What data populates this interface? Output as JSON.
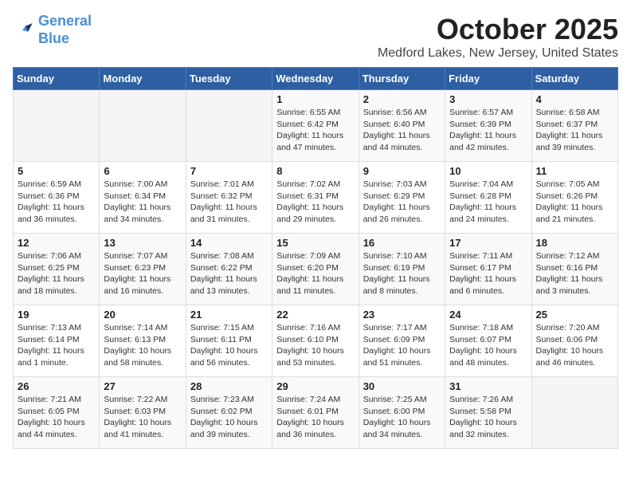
{
  "logo": {
    "line1": "General",
    "line2": "Blue"
  },
  "title": "October 2025",
  "subtitle": "Medford Lakes, New Jersey, United States",
  "weekdays": [
    "Sunday",
    "Monday",
    "Tuesday",
    "Wednesday",
    "Thursday",
    "Friday",
    "Saturday"
  ],
  "weeks": [
    [
      {
        "day": "",
        "info": ""
      },
      {
        "day": "",
        "info": ""
      },
      {
        "day": "",
        "info": ""
      },
      {
        "day": "1",
        "info": "Sunrise: 6:55 AM\nSunset: 6:42 PM\nDaylight: 11 hours and 47 minutes."
      },
      {
        "day": "2",
        "info": "Sunrise: 6:56 AM\nSunset: 6:40 PM\nDaylight: 11 hours and 44 minutes."
      },
      {
        "day": "3",
        "info": "Sunrise: 6:57 AM\nSunset: 6:39 PM\nDaylight: 11 hours and 42 minutes."
      },
      {
        "day": "4",
        "info": "Sunrise: 6:58 AM\nSunset: 6:37 PM\nDaylight: 11 hours and 39 minutes."
      }
    ],
    [
      {
        "day": "5",
        "info": "Sunrise: 6:59 AM\nSunset: 6:36 PM\nDaylight: 11 hours and 36 minutes."
      },
      {
        "day": "6",
        "info": "Sunrise: 7:00 AM\nSunset: 6:34 PM\nDaylight: 11 hours and 34 minutes."
      },
      {
        "day": "7",
        "info": "Sunrise: 7:01 AM\nSunset: 6:32 PM\nDaylight: 11 hours and 31 minutes."
      },
      {
        "day": "8",
        "info": "Sunrise: 7:02 AM\nSunset: 6:31 PM\nDaylight: 11 hours and 29 minutes."
      },
      {
        "day": "9",
        "info": "Sunrise: 7:03 AM\nSunset: 6:29 PM\nDaylight: 11 hours and 26 minutes."
      },
      {
        "day": "10",
        "info": "Sunrise: 7:04 AM\nSunset: 6:28 PM\nDaylight: 11 hours and 24 minutes."
      },
      {
        "day": "11",
        "info": "Sunrise: 7:05 AM\nSunset: 6:26 PM\nDaylight: 11 hours and 21 minutes."
      }
    ],
    [
      {
        "day": "12",
        "info": "Sunrise: 7:06 AM\nSunset: 6:25 PM\nDaylight: 11 hours and 18 minutes."
      },
      {
        "day": "13",
        "info": "Sunrise: 7:07 AM\nSunset: 6:23 PM\nDaylight: 11 hours and 16 minutes."
      },
      {
        "day": "14",
        "info": "Sunrise: 7:08 AM\nSunset: 6:22 PM\nDaylight: 11 hours and 13 minutes."
      },
      {
        "day": "15",
        "info": "Sunrise: 7:09 AM\nSunset: 6:20 PM\nDaylight: 11 hours and 11 minutes."
      },
      {
        "day": "16",
        "info": "Sunrise: 7:10 AM\nSunset: 6:19 PM\nDaylight: 11 hours and 8 minutes."
      },
      {
        "day": "17",
        "info": "Sunrise: 7:11 AM\nSunset: 6:17 PM\nDaylight: 11 hours and 6 minutes."
      },
      {
        "day": "18",
        "info": "Sunrise: 7:12 AM\nSunset: 6:16 PM\nDaylight: 11 hours and 3 minutes."
      }
    ],
    [
      {
        "day": "19",
        "info": "Sunrise: 7:13 AM\nSunset: 6:14 PM\nDaylight: 11 hours and 1 minute."
      },
      {
        "day": "20",
        "info": "Sunrise: 7:14 AM\nSunset: 6:13 PM\nDaylight: 10 hours and 58 minutes."
      },
      {
        "day": "21",
        "info": "Sunrise: 7:15 AM\nSunset: 6:11 PM\nDaylight: 10 hours and 56 minutes."
      },
      {
        "day": "22",
        "info": "Sunrise: 7:16 AM\nSunset: 6:10 PM\nDaylight: 10 hours and 53 minutes."
      },
      {
        "day": "23",
        "info": "Sunrise: 7:17 AM\nSunset: 6:09 PM\nDaylight: 10 hours and 51 minutes."
      },
      {
        "day": "24",
        "info": "Sunrise: 7:18 AM\nSunset: 6:07 PM\nDaylight: 10 hours and 48 minutes."
      },
      {
        "day": "25",
        "info": "Sunrise: 7:20 AM\nSunset: 6:06 PM\nDaylight: 10 hours and 46 minutes."
      }
    ],
    [
      {
        "day": "26",
        "info": "Sunrise: 7:21 AM\nSunset: 6:05 PM\nDaylight: 10 hours and 44 minutes."
      },
      {
        "day": "27",
        "info": "Sunrise: 7:22 AM\nSunset: 6:03 PM\nDaylight: 10 hours and 41 minutes."
      },
      {
        "day": "28",
        "info": "Sunrise: 7:23 AM\nSunset: 6:02 PM\nDaylight: 10 hours and 39 minutes."
      },
      {
        "day": "29",
        "info": "Sunrise: 7:24 AM\nSunset: 6:01 PM\nDaylight: 10 hours and 36 minutes."
      },
      {
        "day": "30",
        "info": "Sunrise: 7:25 AM\nSunset: 6:00 PM\nDaylight: 10 hours and 34 minutes."
      },
      {
        "day": "31",
        "info": "Sunrise: 7:26 AM\nSunset: 5:58 PM\nDaylight: 10 hours and 32 minutes."
      },
      {
        "day": "",
        "info": ""
      }
    ]
  ]
}
